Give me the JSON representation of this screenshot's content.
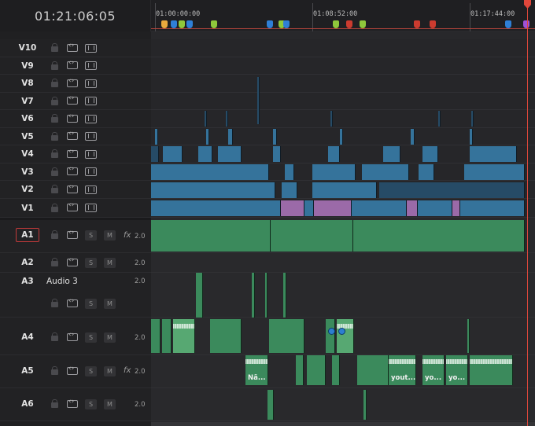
{
  "header": {
    "timecode": "01:21:06:05"
  },
  "ruler": {
    "labels": [
      "01:00:00:00",
      "01:08:52:00",
      "01:17:44:00"
    ],
    "marker_colors": [
      "#e9a93d",
      "#2f7fd6",
      "#8fc83b",
      "#cc3b2f",
      "#9f52d8"
    ]
  },
  "video_tracks": [
    {
      "name": "V10",
      "lock_icon": "lock-icon",
      "auto_icon": "auto-track-icon",
      "enable_icon": "film-icon"
    },
    {
      "name": "V9"
    },
    {
      "name": "V8"
    },
    {
      "name": "V7"
    },
    {
      "name": "V6"
    },
    {
      "name": "V5"
    },
    {
      "name": "V4"
    },
    {
      "name": "V3"
    },
    {
      "name": "V2"
    },
    {
      "name": "V1"
    }
  ],
  "audio_tracks": [
    {
      "name": "A1",
      "fx": "fx",
      "volume": "2.0",
      "solo": "S",
      "mute": "M"
    },
    {
      "name": "A2",
      "volume": "2.0",
      "solo": "S",
      "mute": "M"
    },
    {
      "name": "A3",
      "title": "Audio 3",
      "volume": "2.0",
      "solo": "S",
      "mute": "M"
    },
    {
      "name": "A4",
      "volume": "2.0",
      "solo": "S",
      "mute": "M"
    },
    {
      "name": "A5",
      "fx": "fx",
      "volume": "2.0",
      "solo": "S",
      "mute": "M"
    },
    {
      "name": "A6",
      "volume": "2.0",
      "solo": "S",
      "mute": "M"
    }
  ],
  "clip_labels": [
    "Nã...",
    "yout...",
    "yo...",
    "yo..."
  ]
}
